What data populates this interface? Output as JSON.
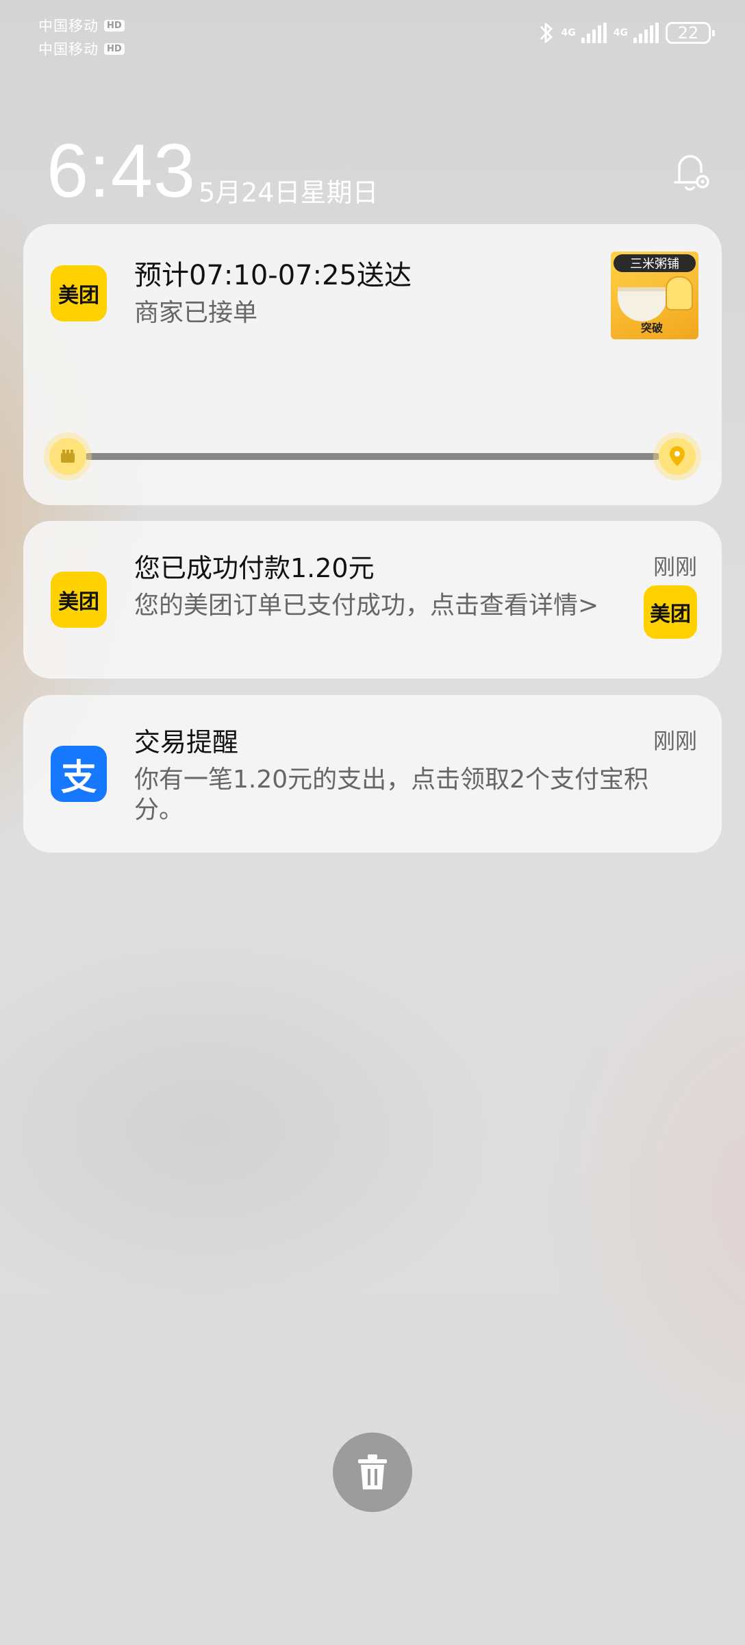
{
  "status_bar": {
    "carrier1": "中国移动",
    "carrier2": "中国移动",
    "hd_badge": "HD",
    "net1": "4G",
    "net2": "4G",
    "battery": "22"
  },
  "lockscreen": {
    "time": "6:43",
    "date": "5月24日星期日"
  },
  "notifications": [
    {
      "app_icon_text": "美团",
      "title": "预计07:10-07:25送达",
      "subtitle": "商家已接单",
      "thumbnail_title": "三米粥铺",
      "thumbnail_badge": "突破",
      "delivery_progress": 1.0
    },
    {
      "app_icon_text": "美团",
      "title": "您已成功付款1.20元",
      "body": "您的美团订单已支付成功，点击查看详情>",
      "time": "刚刚",
      "right_icon_text": "美团"
    },
    {
      "app_icon_text": "支",
      "title": "交易提醒",
      "body": "你有一笔1.20元的支出，点击领取2个支付宝积分。",
      "time": "刚刚"
    }
  ],
  "icons": {
    "bluetooth": "bluetooth-icon",
    "bell": "notification-settings-icon",
    "trash": "trash-icon"
  },
  "colors": {
    "meituan_yellow": "#ffd100",
    "alipay_blue": "#1677ff"
  }
}
